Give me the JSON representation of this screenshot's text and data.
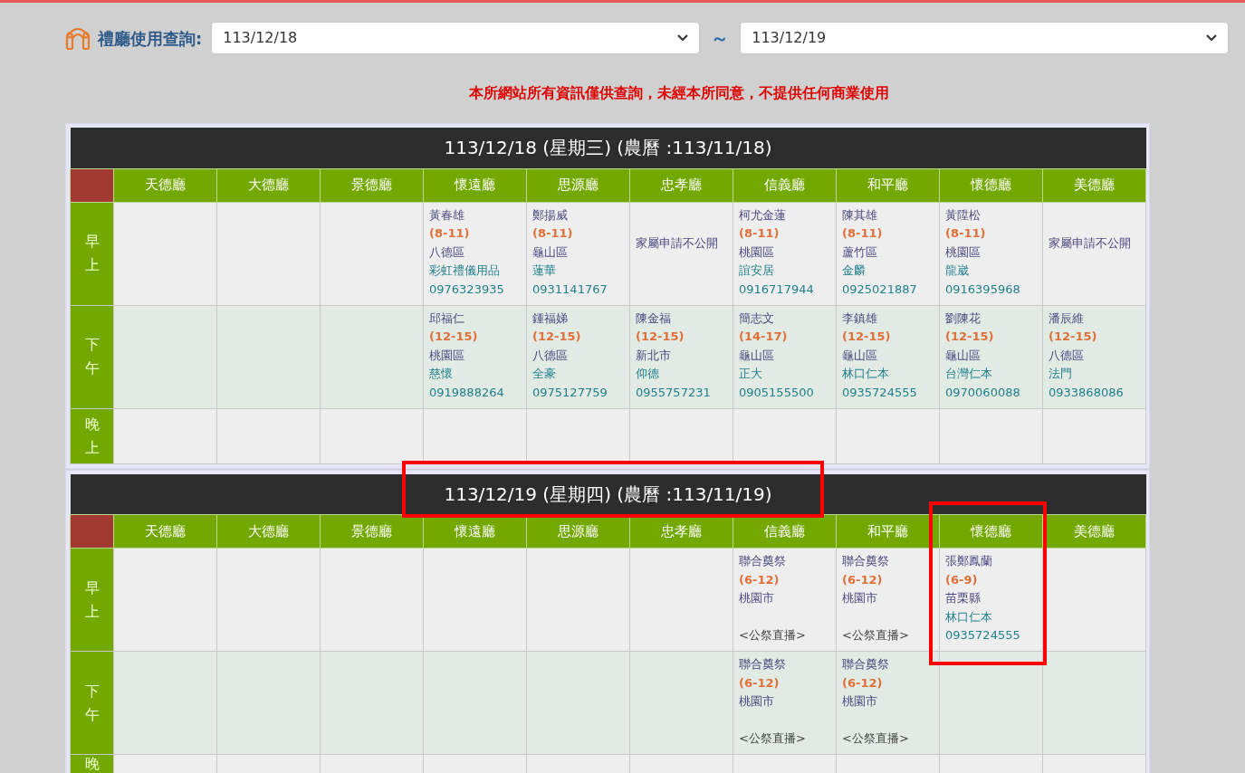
{
  "filter": {
    "label": "禮廳使用查詢:",
    "from": "113/12/18",
    "separator": "～",
    "to": "113/12/19"
  },
  "notice": "本所網站所有資訊僅供查詢，未經本所同意，不提供任何商業使用",
  "days": [
    {
      "title": "113/12/18 (星期三) (農曆 :113/11/18)",
      "columns": [
        "天德廳",
        "大德廳",
        "景德廳",
        "懷遠廳",
        "思源廳",
        "忠孝廳",
        "信義廳",
        "和平廳",
        "懷德廳",
        "美德廳"
      ],
      "rows": [
        {
          "period": "早上",
          "cells": [
            {
              "kind": "empty"
            },
            {
              "kind": "empty"
            },
            {
              "kind": "empty"
            },
            {
              "kind": "booking",
              "name": "黃春雄",
              "time": "(8-11)",
              "district": "八德區",
              "vendor": "彩虹禮儀用品",
              "phone": "0976323935"
            },
            {
              "kind": "booking",
              "name": "鄭揚威",
              "time": "(8-11)",
              "district": "龜山區",
              "vendor": "蓮華",
              "phone": "0931141767"
            },
            {
              "kind": "private",
              "text": "家屬申請不公開"
            },
            {
              "kind": "booking",
              "name": "柯尤金蓮",
              "time": "(8-11)",
              "district": "桃園區",
              "vendor": "誼安居",
              "phone": "0916717944"
            },
            {
              "kind": "booking",
              "name": "陳其雄",
              "time": "(8-11)",
              "district": "蘆竹區",
              "vendor": "金麟",
              "phone": "0925021887"
            },
            {
              "kind": "booking",
              "name": "黃陞松",
              "time": "(8-11)",
              "district": "桃園區",
              "vendor": "龍崴",
              "phone": "0916395968"
            },
            {
              "kind": "private",
              "text": "家屬申請不公開"
            }
          ]
        },
        {
          "period": "下午",
          "cells": [
            {
              "kind": "empty"
            },
            {
              "kind": "empty"
            },
            {
              "kind": "empty"
            },
            {
              "kind": "booking",
              "name": "邱福仁",
              "time": "(12-15)",
              "district": "桃園區",
              "vendor": "慈懷",
              "phone": "0919888264"
            },
            {
              "kind": "booking",
              "name": "鍾福娣",
              "time": "(12-15)",
              "district": "八德區",
              "vendor": "全豪",
              "phone": "0975127759"
            },
            {
              "kind": "booking",
              "name": "陳金福",
              "time": "(12-15)",
              "district": "新北市",
              "vendor": "仰德",
              "phone": "0955757231"
            },
            {
              "kind": "booking",
              "name": "簡志文",
              "time": "(14-17)",
              "district": "龜山區",
              "vendor": "正大",
              "phone": "0905155500"
            },
            {
              "kind": "booking",
              "name": "李鎮雄",
              "time": "(12-15)",
              "district": "龜山區",
              "vendor": "林口仁本",
              "phone": "0935724555"
            },
            {
              "kind": "booking",
              "name": "劉陳花",
              "time": "(12-15)",
              "district": "龜山區",
              "vendor": "台灣仁本",
              "phone": "0970060088"
            },
            {
              "kind": "booking",
              "name": "潘辰維",
              "time": "(12-15)",
              "district": "八德區",
              "vendor": "法門",
              "phone": "0933868086"
            }
          ]
        },
        {
          "period": "晚上",
          "cells": [
            {
              "kind": "empty"
            },
            {
              "kind": "empty"
            },
            {
              "kind": "empty"
            },
            {
              "kind": "empty"
            },
            {
              "kind": "empty"
            },
            {
              "kind": "empty"
            },
            {
              "kind": "empty"
            },
            {
              "kind": "empty"
            },
            {
              "kind": "empty"
            },
            {
              "kind": "empty"
            }
          ]
        }
      ]
    },
    {
      "title": "113/12/19 (星期四) (農曆 :113/11/19)",
      "columns": [
        "天德廳",
        "大德廳",
        "景德廳",
        "懷遠廳",
        "思源廳",
        "忠孝廳",
        "信義廳",
        "和平廳",
        "懷德廳",
        "美德廳"
      ],
      "rows": [
        {
          "period": "早上",
          "cells": [
            {
              "kind": "empty"
            },
            {
              "kind": "empty"
            },
            {
              "kind": "empty"
            },
            {
              "kind": "empty"
            },
            {
              "kind": "empty"
            },
            {
              "kind": "empty"
            },
            {
              "kind": "public",
              "name": "聯合奠祭",
              "time": "(6-12)",
              "district": "桃園市",
              "note": "<公祭直播>"
            },
            {
              "kind": "public",
              "name": "聯合奠祭",
              "time": "(6-12)",
              "district": "桃園市",
              "note": "<公祭直播>"
            },
            {
              "kind": "booking",
              "name": "張鄭鳳蘭",
              "time": "(6-9)",
              "district": "苗栗縣",
              "vendor": "林口仁本",
              "phone": "0935724555"
            },
            {
              "kind": "empty"
            }
          ]
        },
        {
          "period": "下午",
          "cells": [
            {
              "kind": "empty"
            },
            {
              "kind": "empty"
            },
            {
              "kind": "empty"
            },
            {
              "kind": "empty"
            },
            {
              "kind": "empty"
            },
            {
              "kind": "empty"
            },
            {
              "kind": "public",
              "name": "聯合奠祭",
              "time": "(6-12)",
              "district": "桃園市",
              "note": "<公祭直播>"
            },
            {
              "kind": "public",
              "name": "聯合奠祭",
              "time": "(6-12)",
              "district": "桃園市",
              "note": "<公祭直播>"
            },
            {
              "kind": "empty"
            },
            {
              "kind": "empty"
            }
          ]
        },
        {
          "period": "晚",
          "cells": [
            {
              "kind": "empty"
            },
            {
              "kind": "empty"
            },
            {
              "kind": "empty"
            },
            {
              "kind": "empty"
            },
            {
              "kind": "empty"
            },
            {
              "kind": "empty"
            },
            {
              "kind": "empty"
            },
            {
              "kind": "empty"
            },
            {
              "kind": "empty"
            },
            {
              "kind": "empty"
            }
          ]
        }
      ]
    }
  ]
}
